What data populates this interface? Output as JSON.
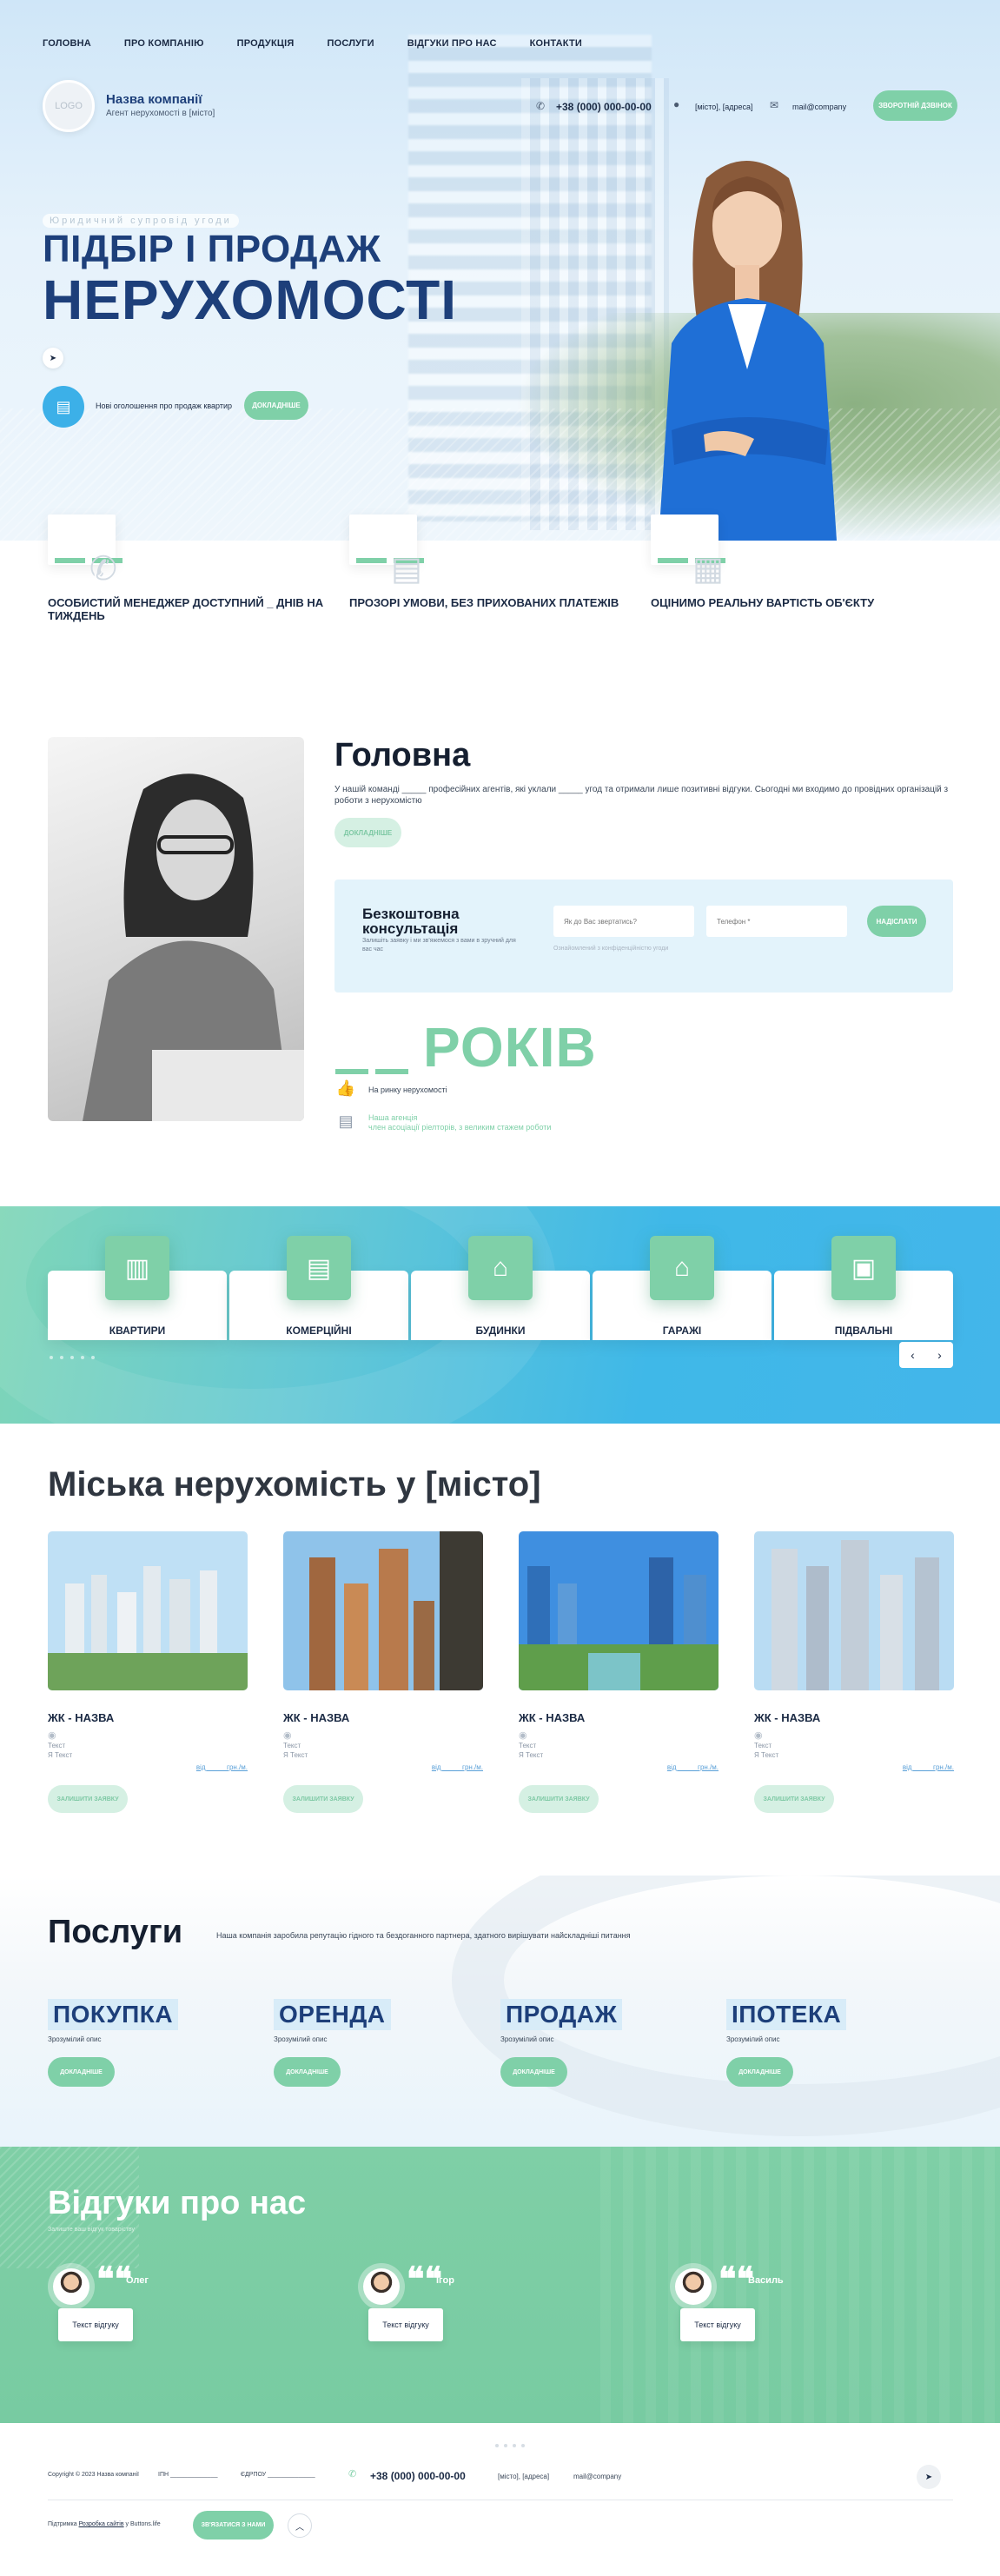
{
  "nav": {
    "items": [
      "ГОЛОВНА",
      "ПРО КОМПАНІЮ",
      "ПРОДУКЦІЯ",
      "ПОСЛУГИ",
      "ВІДГУКИ ПРО НАС",
      "КОНТАКТИ"
    ]
  },
  "header": {
    "logo_text": "LOGO",
    "company_name": "Назва компанії",
    "company_sub": "Агент нерухомості в [місто]",
    "phone": "+38 (000) 000-00-00",
    "address": "[місто], [адреса]",
    "email": "mail@company",
    "callback_label": "ЗВОРОТНІЙ ДЗВІНОК"
  },
  "hero": {
    "tag": "Юридичний супровід угоди",
    "title_line1": "ПІДБІР І ПРОДАЖ",
    "title_line2": "НЕРУХОМОСТІ",
    "note": "Нові оголошення про продаж квартир",
    "more_label": "ДОКЛАДНІШЕ"
  },
  "features": [
    {
      "icon": "phone-icon",
      "text": "ОСОБИСТИЙ МЕНЕДЖЕР ДОСТУПНИЙ _ ДНІВ НА ТИЖДЕНЬ"
    },
    {
      "icon": "document-icon",
      "text": "ПРОЗОРІ УМОВИ, БЕЗ ПРИХОВАНИХ ПЛАТЕЖІВ"
    },
    {
      "icon": "calculator-icon",
      "text": "ОЦІНИМО РЕАЛЬНУ ВАРТІСТЬ ОБ'ЄКТУ"
    }
  ],
  "about": {
    "title": "Головна",
    "text": "У нашій команді _____ професійних агентів, які уклали _____ угод та отримали лише позитивні відгуки. Сьогодні ми входимо до провідних організацій з роботи з нерухомістю",
    "more_label": "ДОКЛАДНІШЕ"
  },
  "consult": {
    "title": "Безкоштовна консультація",
    "sub": "Залишіть заявку і ми зв'яжемося з вами в зручний для вас час",
    "name_placeholder": "Як до Вас звертатись?",
    "phone_placeholder": "Телефон *",
    "agree": "Ознайомлений з конфіденційністю угоди",
    "send_label": "НАДІСЛАТИ"
  },
  "years": {
    "word": "РОКІВ",
    "row1_text": "На ринку нерухомості",
    "row2_line1": "Наша агенція",
    "row2_line2": "член асоціації ріелторів, з великим стажем роботи"
  },
  "categories": [
    {
      "icon": "apartment-icon",
      "label": "КВАРТИРИ"
    },
    {
      "icon": "office-building-icon",
      "label": "КОМЕРЦІЙНІ"
    },
    {
      "icon": "house-icon",
      "label": "БУДИНКИ"
    },
    {
      "icon": "garage-icon",
      "label": "ГАРАЖІ"
    },
    {
      "icon": "floor-plan-icon",
      "label": "ПІДВАЛЬНІ"
    }
  ],
  "city": {
    "title": "Міська нерухомість у [місто]",
    "cards": [
      {
        "name": "ЖК - НАЗВА",
        "t1": "Текст",
        "t2": "Я Текст",
        "price": "від_____ грн./м.",
        "btn": "ЗАЛИШИТИ ЗАЯВКУ"
      },
      {
        "name": "ЖК - НАЗВА",
        "t1": "Текст",
        "t2": "Я Текст",
        "price": "від_____ грн./м.",
        "btn": "ЗАЛИШИТИ ЗАЯВКУ"
      },
      {
        "name": "ЖК - НАЗВА",
        "t1": "Текст",
        "t2": "Я Текст",
        "price": "від_____ грн./м.",
        "btn": "ЗАЛИШИТИ ЗАЯВКУ"
      },
      {
        "name": "ЖК - НАЗВА",
        "t1": "Текст",
        "t2": "Я Текст",
        "price": "від_____ грн./м.",
        "btn": "ЗАЛИШИТИ ЗАЯВКУ"
      }
    ]
  },
  "services": {
    "title": "Послуги",
    "sub": "Наша компанія заробила репутацію гідного та бездоганного партнера, здатного вирішувати найскладніші питання",
    "items": [
      {
        "name": "ПОКУПКА",
        "desc": "Зрозумілий опис",
        "btn": "ДОКЛАДНІШЕ"
      },
      {
        "name": "ОРЕНДА",
        "desc": "Зрозумілий опис",
        "btn": "ДОКЛАДНІШЕ"
      },
      {
        "name": "ПРОДАЖ",
        "desc": "Зрозумілий опис",
        "btn": "ДОКЛАДНІШЕ"
      },
      {
        "name": "ІПОТЕКА",
        "desc": "Зрозумілий опис",
        "btn": "ДОКЛАДНІШЕ"
      }
    ]
  },
  "reviews": {
    "title": "Відгуки про нас",
    "sub": "Залиште ваш відгук товаріству",
    "items": [
      {
        "name": "Олег",
        "text": "Текст відгуку"
      },
      {
        "name": "Ігор",
        "text": "Текст відгуку"
      },
      {
        "name": "Василь",
        "text": "Текст відгуку"
      }
    ]
  },
  "footer": {
    "copyright": "Copyright © 2023 Назва компанії",
    "inn": "ІПН ______________",
    "edrpou": "ЄДРПОУ ______________",
    "phone": "+38 (000) 000-00-00",
    "address": "[місто], [адреса]",
    "email": "mail@company",
    "dev_prefix": "Підтримка",
    "dev_link": "Розробка сайтів",
    "dev_suffix": "у Buttons.life",
    "contact_label": "ЗВ'ЯЗАТИСЯ З НАМИ"
  }
}
